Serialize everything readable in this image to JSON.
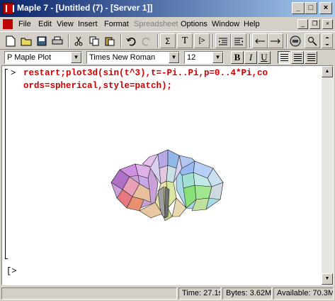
{
  "window": {
    "title": "Maple 7 - [Untitled (7) - [Server 1]]",
    "minimize_glyph": "_",
    "maximize_glyph": "□",
    "close_glyph": "×"
  },
  "menu": {
    "items": [
      {
        "label": "File",
        "enabled": true
      },
      {
        "label": "Edit",
        "enabled": true
      },
      {
        "label": "View",
        "enabled": true
      },
      {
        "label": "Insert",
        "enabled": true
      },
      {
        "label": "Format",
        "enabled": true
      },
      {
        "label": "Spreadsheet",
        "enabled": false
      },
      {
        "label": "Options",
        "enabled": true
      },
      {
        "label": "Window",
        "enabled": true
      },
      {
        "label": "Help",
        "enabled": true
      }
    ]
  },
  "toolbar": {
    "text_button": "T",
    "math_button": "[>",
    "sigma_button": "Σ"
  },
  "format": {
    "style": "P Maple Plot",
    "font": "Times New Roman",
    "size": "12",
    "bold": "B",
    "italic": "I",
    "underline": "U"
  },
  "worksheet": {
    "prompt1": ">",
    "command_line1": "restart;plot3d(sin(t^3),t=-Pi..Pi,p=0..4*Pi,co",
    "command_line2": "ords=spherical,style=patch);",
    "prompt2": "[>"
  },
  "status": {
    "time": "Time: 27.1s",
    "bytes": "Bytes: 3.62M",
    "available": "Available: 70.3M"
  },
  "colors": {
    "titlebar_start": "#0a246a",
    "command_text": "#d00000"
  }
}
